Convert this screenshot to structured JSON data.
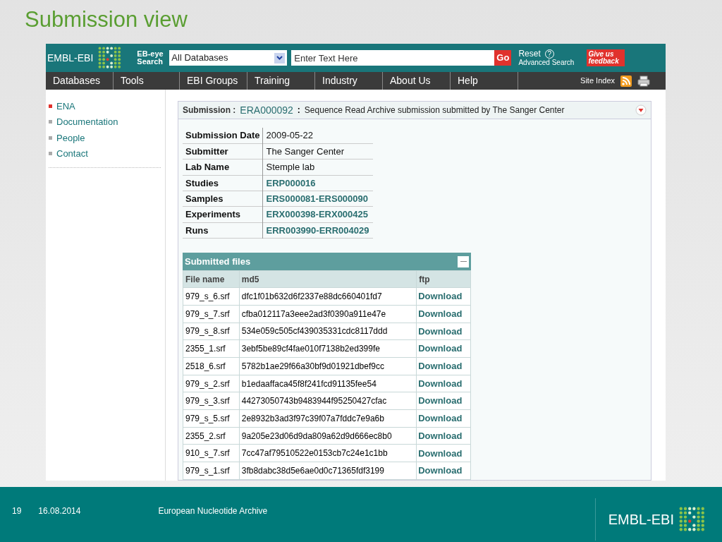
{
  "slide": {
    "title": "Submission view"
  },
  "header": {
    "logo": "EMBL-EBI",
    "search_label": "EB-eye Search",
    "database_select": "All Databases",
    "search_placeholder": "Enter Text Here",
    "go_button": "Go",
    "reset_link": "Reset",
    "help_icon": "?",
    "advanced_search": "Advanced Search",
    "feedback_button": "Give us feedback"
  },
  "nav": {
    "items": [
      {
        "label": "Databases"
      },
      {
        "label": "Tools"
      },
      {
        "label": "EBI Groups"
      },
      {
        "label": "Training"
      },
      {
        "label": "Industry"
      },
      {
        "label": "About Us"
      },
      {
        "label": "Help"
      }
    ],
    "site_index": "Site Index"
  },
  "sidebar": {
    "items": [
      {
        "label": "ENA",
        "selected": true
      },
      {
        "label": "Documentation",
        "selected": false
      },
      {
        "label": "People",
        "selected": false
      },
      {
        "label": "Contact",
        "selected": false
      }
    ]
  },
  "submission": {
    "label": "Submission :",
    "accession": "ERA000092",
    "separator": ":",
    "description": "Sequence Read Archive submission submitted by The Sanger Center"
  },
  "details": [
    {
      "label": "Submission Date",
      "value": "2009-05-22",
      "kind": "text"
    },
    {
      "label": "Submitter",
      "value": "The Sanger Center",
      "kind": "text"
    },
    {
      "label": "Lab Name",
      "value": "Stemple lab",
      "kind": "text"
    },
    {
      "label": "Studies",
      "value": "ERP000016",
      "kind": "link"
    },
    {
      "label": "Samples",
      "value": "ERS000081-ERS000090",
      "kind": "link"
    },
    {
      "label": "Experiments",
      "value": "ERX000398-ERX000425",
      "kind": "link"
    },
    {
      "label": "Runs",
      "value": "ERR003990-ERR004029",
      "kind": "link"
    }
  ],
  "files": {
    "title": "Submitted files",
    "columns": [
      "File name",
      "md5",
      "ftp"
    ],
    "rows": [
      {
        "file_name": "979_s_6.srf",
        "md5": "dfc1f01b632d6f2337e88dc660401fd7",
        "ftp": "Download"
      },
      {
        "file_name": "979_s_7.srf",
        "md5": "cfba012117a3eee2ad3f0390a911e47e",
        "ftp": "Download"
      },
      {
        "file_name": "979_s_8.srf",
        "md5": "534e059c505cf439035331cdc8117ddd",
        "ftp": "Download"
      },
      {
        "file_name": "2355_1.srf",
        "md5": "3ebf5be89cf4fae010f7138b2ed399fe",
        "ftp": "Download"
      },
      {
        "file_name": "2518_6.srf",
        "md5": "5782b1ae29f66a30bf9d01921dbef9cc",
        "ftp": "Download"
      },
      {
        "file_name": "979_s_2.srf",
        "md5": "b1edaaffaca45f8f241fcd91135fee54",
        "ftp": "Download"
      },
      {
        "file_name": "979_s_3.srf",
        "md5": "44273050743b9483944f95250427cfac",
        "ftp": "Download"
      },
      {
        "file_name": "979_s_5.srf",
        "md5": "2e8932b3ad3f97c39f07a7fddc7e9a6b",
        "ftp": "Download"
      },
      {
        "file_name": "2355_2.srf",
        "md5": "9a205e23d06d9da809a62d9d666ec8b0",
        "ftp": "Download"
      },
      {
        "file_name": "910_s_7.srf",
        "md5": "7cc47af79510522e0153cb7c24e1c1bb",
        "ftp": "Download"
      },
      {
        "file_name": "979_s_1.srf",
        "md5": "3fb8dabc38d5e6ae0d0c71365fdf3199",
        "ftp": "Download"
      }
    ]
  },
  "footer": {
    "page": "19",
    "date": "16.08.2014",
    "title": "European Nucleotide Archive",
    "logo": "EMBL-EBI"
  }
}
